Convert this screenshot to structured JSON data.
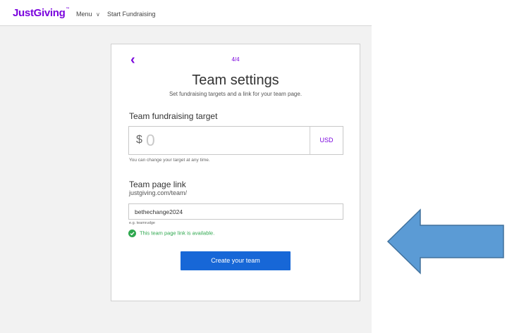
{
  "header": {
    "logo_text": "JustGiving",
    "logo_tm": "™",
    "menu_label": "Menu",
    "start_fundraising": "Start Fundraising"
  },
  "form": {
    "step": "4/4",
    "title": "Team settings",
    "subtitle": "Set fundraising targets and a link for your team page.",
    "target": {
      "label": "Team fundraising target",
      "currency_symbol": "$",
      "amount_placeholder": "0",
      "currency_code": "USD",
      "hint": "You can change your target at any time."
    },
    "link": {
      "label": "Team page link",
      "prefix": "justgiving.com/team/",
      "value": "bethechange2024",
      "example": "e.g. teamrudge",
      "availability": "This team page link is available."
    },
    "submit_label": "Create your team"
  },
  "colors": {
    "brand": "#7a04dd",
    "button": "#1767d7",
    "success": "#2fa84f",
    "annotation_arrow": "#5b9bd5"
  },
  "icons": {
    "back": "chevron-left-icon",
    "menu": "chevron-down-icon",
    "available": "check-circle-icon",
    "annotation": "arrow-left-icon"
  }
}
